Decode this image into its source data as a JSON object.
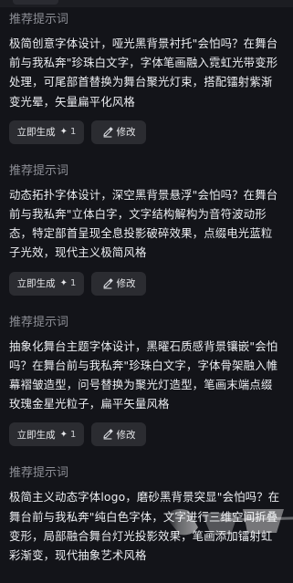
{
  "cards": [
    {
      "label": "推荐提示词",
      "text": "极简创意字体设计，哑光黑背景衬托\"会怕吗？在舞台前与我私奔\"珍珠白文字，字体笔画融入霓虹光带变形处理，可尾部首替换为舞台聚光灯束，搭配镭射紫渐变光晕，矢量扁平化风格",
      "generate_label": "立即生成",
      "cost": "1",
      "edit_label": "修改"
    },
    {
      "label": "推荐提示词",
      "text": "动态拓扑字体设计，深空黑背景悬浮\"会怕吗？在舞台前与我私奔\"立体白字，文字结构解构为音符波动形态，特定部首呈现全息投影破碎效果，点缀电光蓝粒子光效，现代主义极简风格",
      "generate_label": "立即生成",
      "cost": "1",
      "edit_label": "修改"
    },
    {
      "label": "推荐提示词",
      "text": "抽象化舞台主题字体设计，黑曜石质感背景镶嵌\"会怕吗？在舞台前与我私奔\"珍珠白文字，字体骨架融入帷幕褶皱造型，问号替换为聚光灯造型，笔画末端点缀玫瑰金星光粒子，扁平矢量风格",
      "generate_label": "立即生成",
      "cost": "1",
      "edit_label": "修改"
    },
    {
      "label": "推荐提示词",
      "text": "极简主义动态字体logo，磨砂黑背景突显\"会怕吗？在舞台前与我私奔\"纯白色字体，文字进行三维空间折叠变形，局部融合舞台灯光投影效果，笔画添加镭射虹彩渐变，现代抽象艺术风格"
    }
  ]
}
